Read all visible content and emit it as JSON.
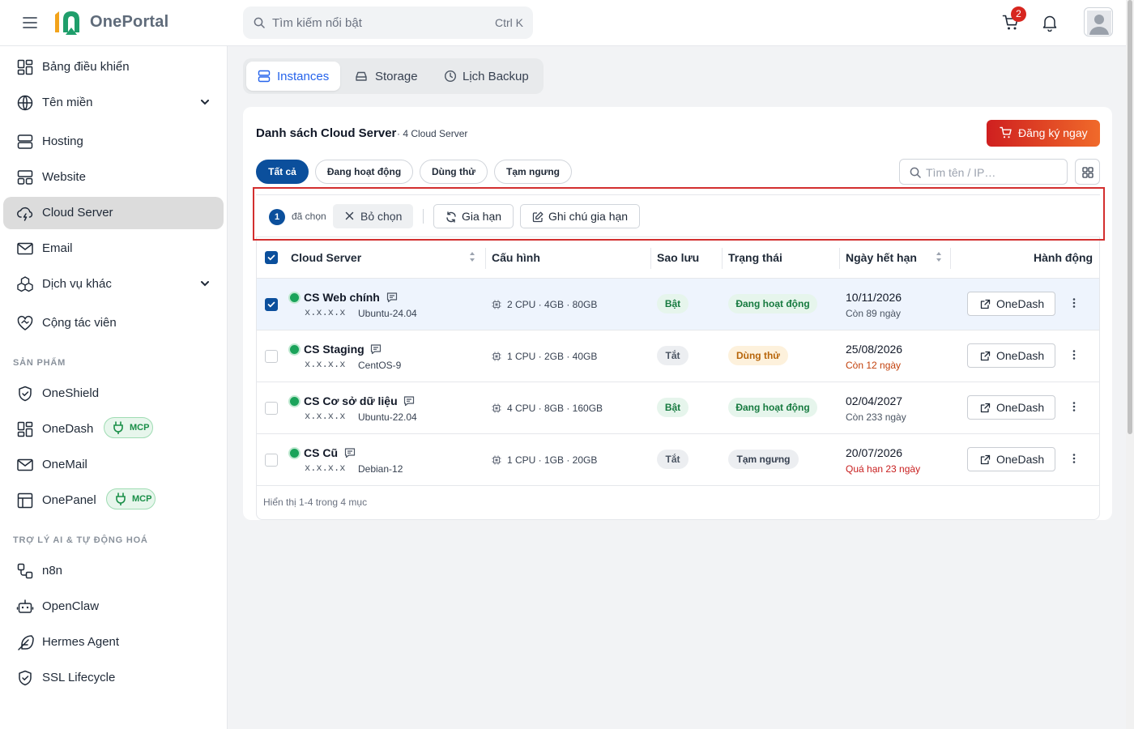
{
  "app": {
    "name": "OnePortal"
  },
  "header": {
    "search_placeholder": "Tìm kiếm nổi bật",
    "search_shortcut": "Ctrl K",
    "cart_count": "2"
  },
  "sidebar": {
    "items": [
      {
        "label": "Bảng điều khiển",
        "icon": "dashboard-icon"
      },
      {
        "label": "Tên miền",
        "icon": "globe-icon",
        "expandable": true
      },
      {
        "label": "Hosting",
        "icon": "server-icon"
      },
      {
        "label": "Website",
        "icon": "website-icon"
      },
      {
        "label": "Cloud Server",
        "icon": "cloud-icon",
        "active": true
      },
      {
        "label": "Email",
        "icon": "mail-icon"
      },
      {
        "label": "Dịch vụ khác",
        "icon": "boxes-icon",
        "expandable": true
      },
      {
        "label": "Cộng tác viên",
        "icon": "handshake-icon"
      }
    ],
    "section_products": "SẢN PHẨM",
    "products": [
      {
        "label": "OneShield",
        "icon": "shield-icon"
      },
      {
        "label": "OneDash",
        "icon": "dashboard-icon",
        "badge": "MCP"
      },
      {
        "label": "OneMail",
        "icon": "mail-icon"
      },
      {
        "label": "OnePanel",
        "icon": "panel-icon",
        "badge": "MCP"
      }
    ],
    "section_ai": "TRỢ LÝ AI & TỰ ĐỘNG HOÁ",
    "ai_items": [
      {
        "label": "n8n",
        "icon": "workflow-icon"
      },
      {
        "label": "OpenClaw",
        "icon": "bot-icon"
      },
      {
        "label": "Hermes Agent",
        "icon": "feather-icon"
      },
      {
        "label": "SSL Lifecycle",
        "icon": "shield-check-icon"
      }
    ]
  },
  "tabs": [
    {
      "label": "Instances",
      "active": true
    },
    {
      "label": "Storage"
    },
    {
      "label": "Lịch Backup"
    }
  ],
  "card": {
    "title": "Danh sách Cloud Server",
    "subtitle": "· 4 Cloud Server",
    "register_label": "Đăng ký ngay",
    "filters": [
      {
        "label": "Tất cả",
        "active": true
      },
      {
        "label": "Đang hoạt động"
      },
      {
        "label": "Dùng thử"
      },
      {
        "label": "Tạm ngưng"
      }
    ],
    "search_placeholder": "Tìm tên / IP…"
  },
  "selection": {
    "count": "1",
    "text": "đã chọn",
    "deselect_label": "Bỏ chọn",
    "renew_label": "Gia hạn",
    "note_label": "Ghi chú gia hạn"
  },
  "table": {
    "columns": [
      "Cloud Server",
      "Cấu hình",
      "Sao lưu",
      "Trạng thái",
      "Ngày hết hạn",
      "Hành động"
    ],
    "rows": [
      {
        "name": "CS Web chính",
        "ip": "x.x.x.x",
        "os": "Ubuntu-24.04",
        "config": "2 CPU · 4GB · 80GB",
        "backup": "Bật",
        "status": "Đang hoạt động",
        "expiry": "10/11/2026",
        "remaining": "Còn 89 ngày",
        "remaining_color": "#4b5563",
        "checked": true,
        "action": "OneDash"
      },
      {
        "name": "CS Staging",
        "ip": "x.x.x.x",
        "os": "CentOS-9",
        "config": "1 CPU · 2GB · 40GB",
        "backup": "Tắt",
        "status": "Dùng thử",
        "expiry": "25/08/2026",
        "remaining": "Còn 12 ngày",
        "remaining_color": "#c2410c",
        "checked": false,
        "action": "OneDash"
      },
      {
        "name": "CS Cơ sở dữ liệu",
        "ip": "x.x.x.x",
        "os": "Ubuntu-22.04",
        "config": "4 CPU · 8GB · 160GB",
        "backup": "Bật",
        "status": "Đang hoạt động",
        "expiry": "02/04/2027",
        "remaining": "Còn 233 ngày",
        "remaining_color": "#4b5563",
        "checked": false,
        "action": "OneDash"
      },
      {
        "name": "CS Cũ",
        "ip": "x.x.x.x",
        "os": "Debian-12",
        "config": "1 CPU · 1GB · 20GB",
        "backup": "Tắt",
        "status": "Tạm ngưng",
        "expiry": "20/07/2026",
        "remaining": "Quá hạn 23 ngày",
        "remaining_color": "#c81e1e",
        "checked": false,
        "action": "OneDash"
      }
    ],
    "footer": "Hiển thị 1-4 trong 4 mục"
  }
}
